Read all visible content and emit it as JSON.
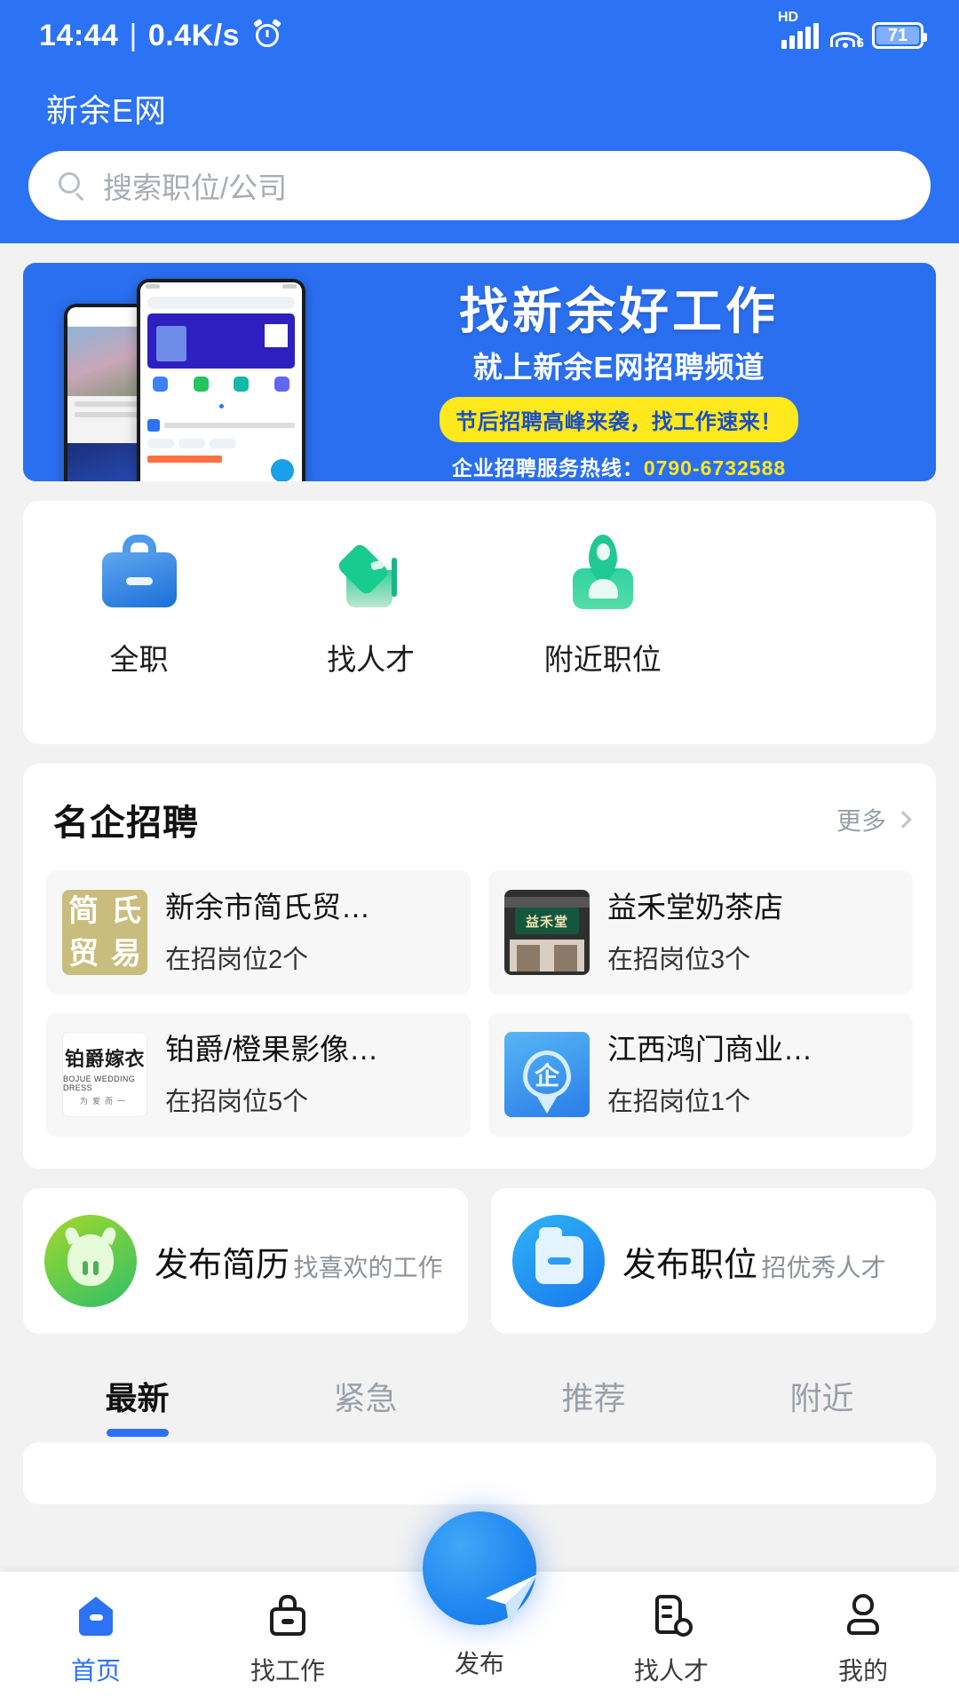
{
  "statusbar": {
    "time": "14:44",
    "separator": "|",
    "netspeed": "0.4K/s",
    "alarm_icon": "alarm-clock-icon",
    "hd_label": "HD",
    "signal_icon": "cellular-signal-icon",
    "wifi_icon": "wifi-icon",
    "wifi_gen": "6",
    "battery_level": "71",
    "battery_icon": "battery-icon"
  },
  "header": {
    "app_title": "新余E网",
    "search": {
      "placeholder": "搜索职位/公司",
      "value": "",
      "icon": "search-icon"
    }
  },
  "banner": {
    "headline": "找新余好工作",
    "subheadline": "就上新余E网招聘频道",
    "pill": "节后招聘高峰来袭，找工作速来！",
    "hotline_label": "企业招聘服务热线：",
    "hotline_number": "0790-6732588",
    "bg_color": "#2a6ff0",
    "pill_color": "#ffe81c"
  },
  "quick_actions": [
    {
      "label": "全职",
      "icon": "briefcase-icon"
    },
    {
      "label": "找人才",
      "icon": "graduation-cap-icon"
    },
    {
      "label": "附近职位",
      "icon": "location-person-icon"
    }
  ],
  "featured": {
    "title": "名企招聘",
    "more_label": "更多",
    "more_icon": "chevron-right-icon",
    "companies": [
      {
        "name": "新余市简氏贸…",
        "jobs": "在招岗位2个",
        "logo": "jianshi-logo",
        "logo_chars": [
          "简",
          "氏",
          "贸",
          "易"
        ]
      },
      {
        "name": "益禾堂奶茶店",
        "jobs": "在招岗位3个",
        "logo": "yihetang-storefront-logo",
        "logo_text": "益禾堂"
      },
      {
        "name": "铂爵/橙果影像…",
        "jobs": "在招岗位5个",
        "logo": "bojue-logo",
        "logo_cn": "铂爵嫁衣",
        "logo_en": "BOJUE WEDDING DRESS",
        "logo_sub": "为爱而一"
      },
      {
        "name": "江西鸿门商业…",
        "jobs": "在招岗位1个",
        "logo": "enterprise-pin-logo",
        "logo_char": "企"
      }
    ]
  },
  "publish_cards": [
    {
      "title": "发布简历",
      "subtitle": "找喜欢的工作",
      "icon": "resume-cow-icon"
    },
    {
      "title": "发布职位",
      "subtitle": "招优秀人才",
      "icon": "folder-icon"
    }
  ],
  "tabs": [
    {
      "label": "最新",
      "active": true
    },
    {
      "label": "紧急",
      "active": false
    },
    {
      "label": "推荐",
      "active": false
    },
    {
      "label": "附近",
      "active": false
    }
  ],
  "bottom_nav": {
    "items": [
      {
        "label": "首页",
        "icon": "home-icon",
        "active": true
      },
      {
        "label": "找工作",
        "icon": "briefcase-outline-icon",
        "active": false
      },
      {
        "label": "找人才",
        "icon": "document-search-icon",
        "active": false
      },
      {
        "label": "我的",
        "icon": "person-icon",
        "active": false
      }
    ],
    "fab": {
      "label": "发布",
      "icon": "paper-plane-icon"
    }
  },
  "theme": {
    "primary": "#2b72f5",
    "page_bg": "#f2f2f2",
    "card_bg": "#ffffff"
  }
}
